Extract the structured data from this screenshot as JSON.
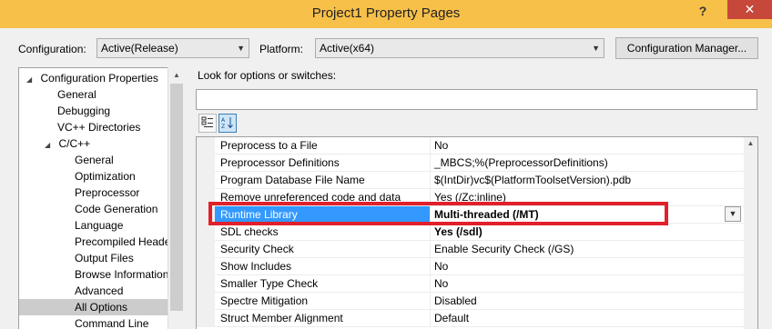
{
  "window": {
    "title": "Project1 Property Pages",
    "help_glyph": "?",
    "close_glyph": "✕",
    "accent_color": "#f7c049",
    "close_color": "#c7473a"
  },
  "toolbar": {
    "configuration_label": "Configuration:",
    "configuration_value": "Active(Release)",
    "platform_label": "Platform:",
    "platform_value": "Active(x64)",
    "config_manager_label": "Configuration Manager..."
  },
  "tree": {
    "items": [
      {
        "label": "Configuration Properties",
        "expander": "◢"
      },
      {
        "label": "General"
      },
      {
        "label": "Debugging"
      },
      {
        "label": "VC++ Directories"
      },
      {
        "label": "C/C++",
        "expander": "◢"
      },
      {
        "label": "General"
      },
      {
        "label": "Optimization"
      },
      {
        "label": "Preprocessor"
      },
      {
        "label": "Code Generation"
      },
      {
        "label": "Language"
      },
      {
        "label": "Precompiled Heade"
      },
      {
        "label": "Output Files"
      },
      {
        "label": "Browse Information"
      },
      {
        "label": "Advanced"
      },
      {
        "label": "All Options",
        "selected": true
      },
      {
        "label": "Command Line"
      }
    ]
  },
  "search": {
    "label": "Look for options or switches:",
    "value": ""
  },
  "view_buttons": {
    "categorized_icon": "categorized-icon",
    "alphabetical_icon": "alphabetical-icon"
  },
  "properties": {
    "rows": [
      {
        "name": "Preprocess to a File",
        "value": "No"
      },
      {
        "name": "Preprocessor Definitions",
        "value": "_MBCS;%(PreprocessorDefinitions)"
      },
      {
        "name": "Program Database File Name",
        "value": "$(IntDir)vc$(PlatformToolsetVersion).pdb"
      },
      {
        "name": "Remove unreferenced code and data",
        "value": "Yes (/Zc:inline)"
      },
      {
        "name": "Runtime Library",
        "value": "Multi-threaded (/MT)",
        "selected": true
      },
      {
        "name": "SDL checks",
        "value": "Yes (/sdl)",
        "bold": true
      },
      {
        "name": "Security Check",
        "value": "Enable Security Check (/GS)"
      },
      {
        "name": "Show Includes",
        "value": "No"
      },
      {
        "name": "Smaller Type Check",
        "value": "No"
      },
      {
        "name": "Spectre Mitigation",
        "value": "Disabled"
      },
      {
        "name": "Struct Member Alignment",
        "value": "Default"
      }
    ],
    "selection_color": "#3399ff",
    "highlight_color": "#e0202a"
  }
}
